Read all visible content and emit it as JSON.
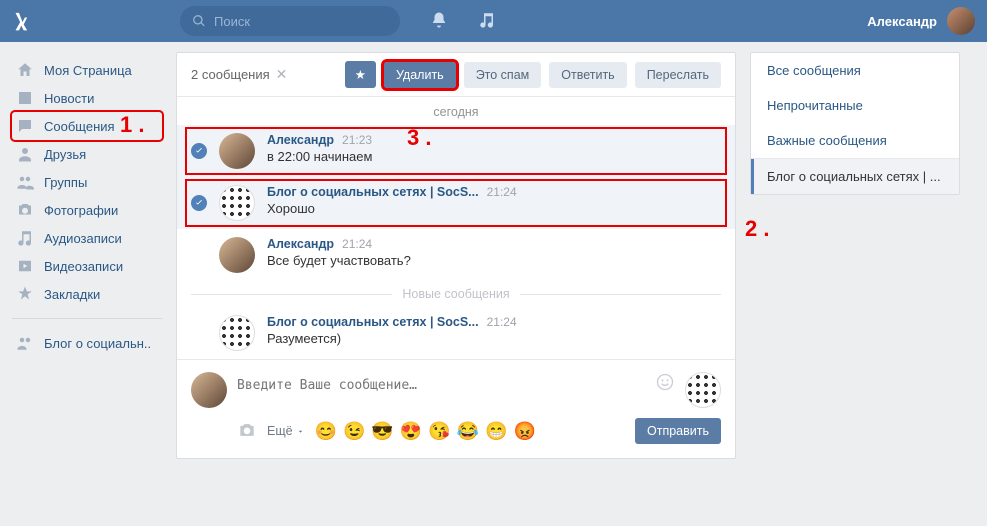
{
  "header": {
    "search_placeholder": "Поиск",
    "username": "Александр"
  },
  "leftnav": {
    "items": [
      {
        "icon": "home",
        "label": "Моя Страница"
      },
      {
        "icon": "news",
        "label": "Новости"
      },
      {
        "icon": "messages",
        "label": "Сообщения",
        "active": true
      },
      {
        "icon": "friends",
        "label": "Друзья"
      },
      {
        "icon": "groups",
        "label": "Группы"
      },
      {
        "icon": "photos",
        "label": "Фотографии"
      },
      {
        "icon": "audio",
        "label": "Аудиозаписи"
      },
      {
        "icon": "video",
        "label": "Видеозаписи"
      },
      {
        "icon": "bookmarks",
        "label": "Закладки"
      }
    ],
    "secondary": [
      {
        "icon": "groups",
        "label": "Блог о социальн.."
      }
    ]
  },
  "conv": {
    "count_label": "2 сообщения",
    "actions": {
      "star": "★",
      "delete": "Удалить",
      "spam": "Это спам",
      "reply": "Ответить",
      "forward": "Переслать"
    },
    "day": "сегодня",
    "new_label": "Новые сообщения",
    "messages": [
      {
        "selected": true,
        "red": true,
        "avatar": "alex",
        "name": "Александр",
        "time": "21:23",
        "text": "в 22:00 начинаем"
      },
      {
        "selected": true,
        "red": true,
        "avatar": "blog",
        "name": "Блог о социальных сетях | SocS...",
        "time": "21:24",
        "text": "Хорошо"
      },
      {
        "selected": false,
        "avatar": "alex",
        "name": "Александр",
        "time": "21:24",
        "text": "Все будет участвовать?"
      }
    ],
    "messages_after_new": [
      {
        "selected": false,
        "avatar": "blog",
        "name": "Блог о социальных сетях | SocS...",
        "time": "21:24",
        "text": "Разумеется)"
      }
    ],
    "composer": {
      "placeholder": "Введите Ваше сообщение…",
      "more": "Ещё",
      "send": "Отправить",
      "emoji": [
        "😊",
        "😉",
        "😎",
        "😍",
        "😘",
        "😂",
        "😁",
        "😡"
      ]
    }
  },
  "right": {
    "items": [
      {
        "label": "Все сообщения"
      },
      {
        "label": "Непрочитанные"
      },
      {
        "label": "Важные сообщения"
      }
    ],
    "selected": {
      "label": "Блог о социальных сетях | ..."
    }
  },
  "annotations": {
    "a1": "1 .",
    "a2": "2 .",
    "a3": "3 ."
  }
}
